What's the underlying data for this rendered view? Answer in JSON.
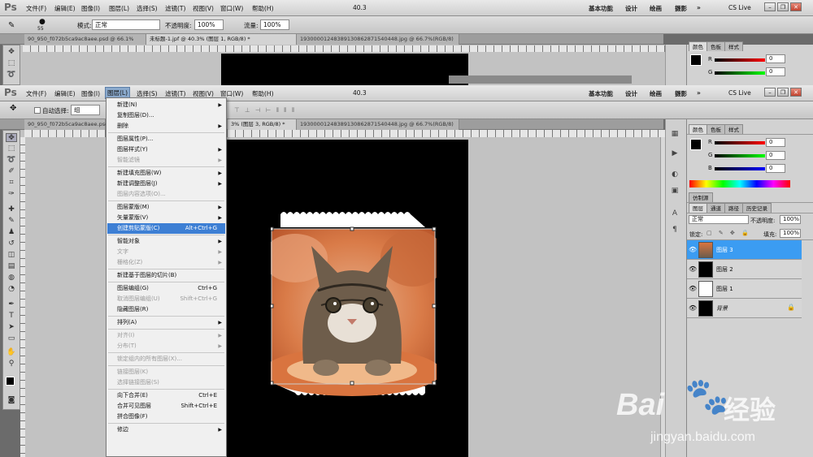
{
  "app": {
    "logo": "Ps"
  },
  "menu": [
    "文件(F)",
    "编辑(E)",
    "图像(I)",
    "图层(L)",
    "选择(S)",
    "滤镜(T)",
    "视图(V)",
    "窗口(W)",
    "帮助(H)"
  ],
  "zoom": "40.3",
  "workspaces": [
    "基本功能",
    "设计",
    "绘画",
    "摄影",
    "»"
  ],
  "cslive": "CS Live",
  "top_options": {
    "brush_size": "55",
    "mode_label": "模式:",
    "mode_value": "正常",
    "opacity_label": "不透明度:",
    "opacity_value": "100%",
    "flow_label": "流量:",
    "flow_value": "100%"
  },
  "top_tabs": [
    "90_950_f072b5ca9ac8aee.psd @ 66.1%(RGB/8) *",
    "未标题-1.jpf @ 40.3% (图层 1, RGB/8) *",
    "19300001248389130862871540448.jpg @ 66.7%(RGB/8)"
  ],
  "move_options": {
    "auto_select_label": "自动选择:",
    "auto_select_value": "组"
  },
  "tabs": [
    "90_950_f072b5ca9ac8aee.psd",
    "3% (图层 3, RGB/8) *",
    "19300001248389130862871540448.jpg @ 66.7%(RGB/8)"
  ],
  "layer_menu": [
    {
      "label": "新建(N)",
      "arrow": true
    },
    {
      "label": "复制图层(D)..."
    },
    {
      "label": "删除",
      "arrow": true
    },
    {
      "sep": true
    },
    {
      "label": "图层属性(P)..."
    },
    {
      "label": "图层样式(Y)",
      "arrow": true
    },
    {
      "label": "智能滤镜",
      "arrow": true,
      "disabled": true
    },
    {
      "sep": true
    },
    {
      "label": "新建填充图层(W)",
      "arrow": true
    },
    {
      "label": "新建调整图层(J)",
      "arrow": true
    },
    {
      "label": "图层内容选项(O)...",
      "disabled": true
    },
    {
      "sep": true
    },
    {
      "label": "图层蒙版(M)",
      "arrow": true
    },
    {
      "label": "矢量蒙版(V)",
      "arrow": true
    },
    {
      "label": "创建剪贴蒙版(C)",
      "shortcut": "Alt+Ctrl+G",
      "highlight": true
    },
    {
      "sep": true
    },
    {
      "label": "智能对象",
      "arrow": true
    },
    {
      "label": "文字",
      "arrow": true,
      "disabled": true
    },
    {
      "label": "栅格化(Z)",
      "arrow": true,
      "disabled": true
    },
    {
      "sep": true
    },
    {
      "label": "新建基于图层的切片(B)"
    },
    {
      "sep": true
    },
    {
      "label": "图层编组(G)",
      "shortcut": "Ctrl+G"
    },
    {
      "label": "取消图层编组(U)",
      "shortcut": "Shift+Ctrl+G",
      "disabled": true
    },
    {
      "label": "隐藏图层(R)"
    },
    {
      "sep": true
    },
    {
      "label": "排列(A)",
      "arrow": true
    },
    {
      "sep": true
    },
    {
      "label": "对齐(I)",
      "arrow": true,
      "disabled": true
    },
    {
      "label": "分布(T)",
      "arrow": true,
      "disabled": true
    },
    {
      "sep": true
    },
    {
      "label": "锁定组内的所有图层(X)...",
      "disabled": true
    },
    {
      "sep": true
    },
    {
      "label": "链接图层(K)",
      "disabled": true
    },
    {
      "label": "选择链接图层(S)",
      "disabled": true
    },
    {
      "sep": true
    },
    {
      "label": "向下合并(E)",
      "shortcut": "Ctrl+E"
    },
    {
      "label": "合并可见图层",
      "shortcut": "Shift+Ctrl+E"
    },
    {
      "label": "拼合图像(F)"
    },
    {
      "sep": true
    },
    {
      "label": "修边",
      "arrow": true
    }
  ],
  "color_panel": {
    "tabs": [
      "颜色",
      "色板",
      "样式"
    ],
    "channels": [
      {
        "label": "R",
        "value": "0"
      },
      {
        "label": "G",
        "value": "0"
      },
      {
        "label": "B",
        "value": "0"
      }
    ]
  },
  "history_tab": "仿制源",
  "layers_panel": {
    "tabs": [
      "图层",
      "通道",
      "路径",
      "历史记录"
    ],
    "blend_mode": "正常",
    "opacity_label": "不透明度:",
    "opacity_value": "100%",
    "lock_label": "锁定:",
    "fill_label": "填充:",
    "fill_value": "100%",
    "layers": [
      {
        "name": "图层 3",
        "selected": true
      },
      {
        "name": "图层 2"
      },
      {
        "name": "图层 1"
      },
      {
        "name": "背景",
        "locked": true
      }
    ]
  },
  "watermark": {
    "brand": "Bai",
    "brand2": "经验",
    "url": "jingyan.baidu.com"
  }
}
